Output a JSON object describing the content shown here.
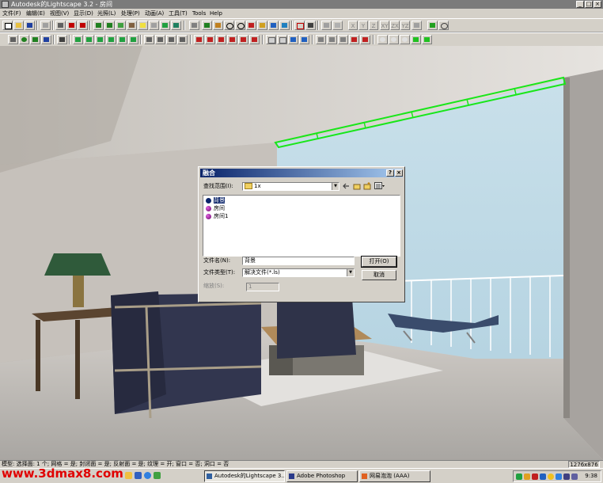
{
  "window": {
    "title": "Autodesk的Lightscape 3.2 - 房间",
    "minimize": "_",
    "maximize": "□",
    "close": "×"
  },
  "menu": [
    "文件(F)",
    "编辑(E)",
    "视图(V)",
    "显示(D)",
    "光照(L)",
    "处理(P)",
    "动画(A)",
    "工具(T)",
    "Tools",
    "Help"
  ],
  "axis_buttons": [
    "X",
    "Y",
    "Z",
    "XY",
    "ZX",
    "YZ"
  ],
  "dialog": {
    "title": "融合",
    "help": "?",
    "close": "×",
    "look_in_label": "查找范围(I):",
    "look_in_value": "1x",
    "files": [
      "背景",
      "房间",
      "房间1"
    ],
    "selected_index": 0,
    "filename_label": "文件名(N):",
    "filename_value": "背景",
    "filetype_label": "文件类型(T):",
    "filetype_value": "解决文件(*.ls)",
    "scale_label": "缩放(S):",
    "scale_value": "1",
    "open_button": "打开(O)",
    "cancel_button": "取消"
  },
  "status": {
    "text": "模型: 选择面: 1 个; 网格 = 是; 封闭面 = 是; 反射面 = 是; 纹理 = 开; 窗口 = 否; 洞口 = 否",
    "resolution": "1276x876"
  },
  "taskbar": {
    "buttons": [
      "Autodesk的Lightscape 3....",
      "Adobe Photoshop",
      "网易泡泡 (AAA)"
    ],
    "active_index": 0,
    "clock": "9:38"
  },
  "watermark": "www.3dmax8.com",
  "colors": {
    "title_gradient_start": "#0a246a",
    "title_gradient_end": "#a6caf0",
    "highlight_green": "#19e619",
    "watermark_red": "#e00000"
  }
}
